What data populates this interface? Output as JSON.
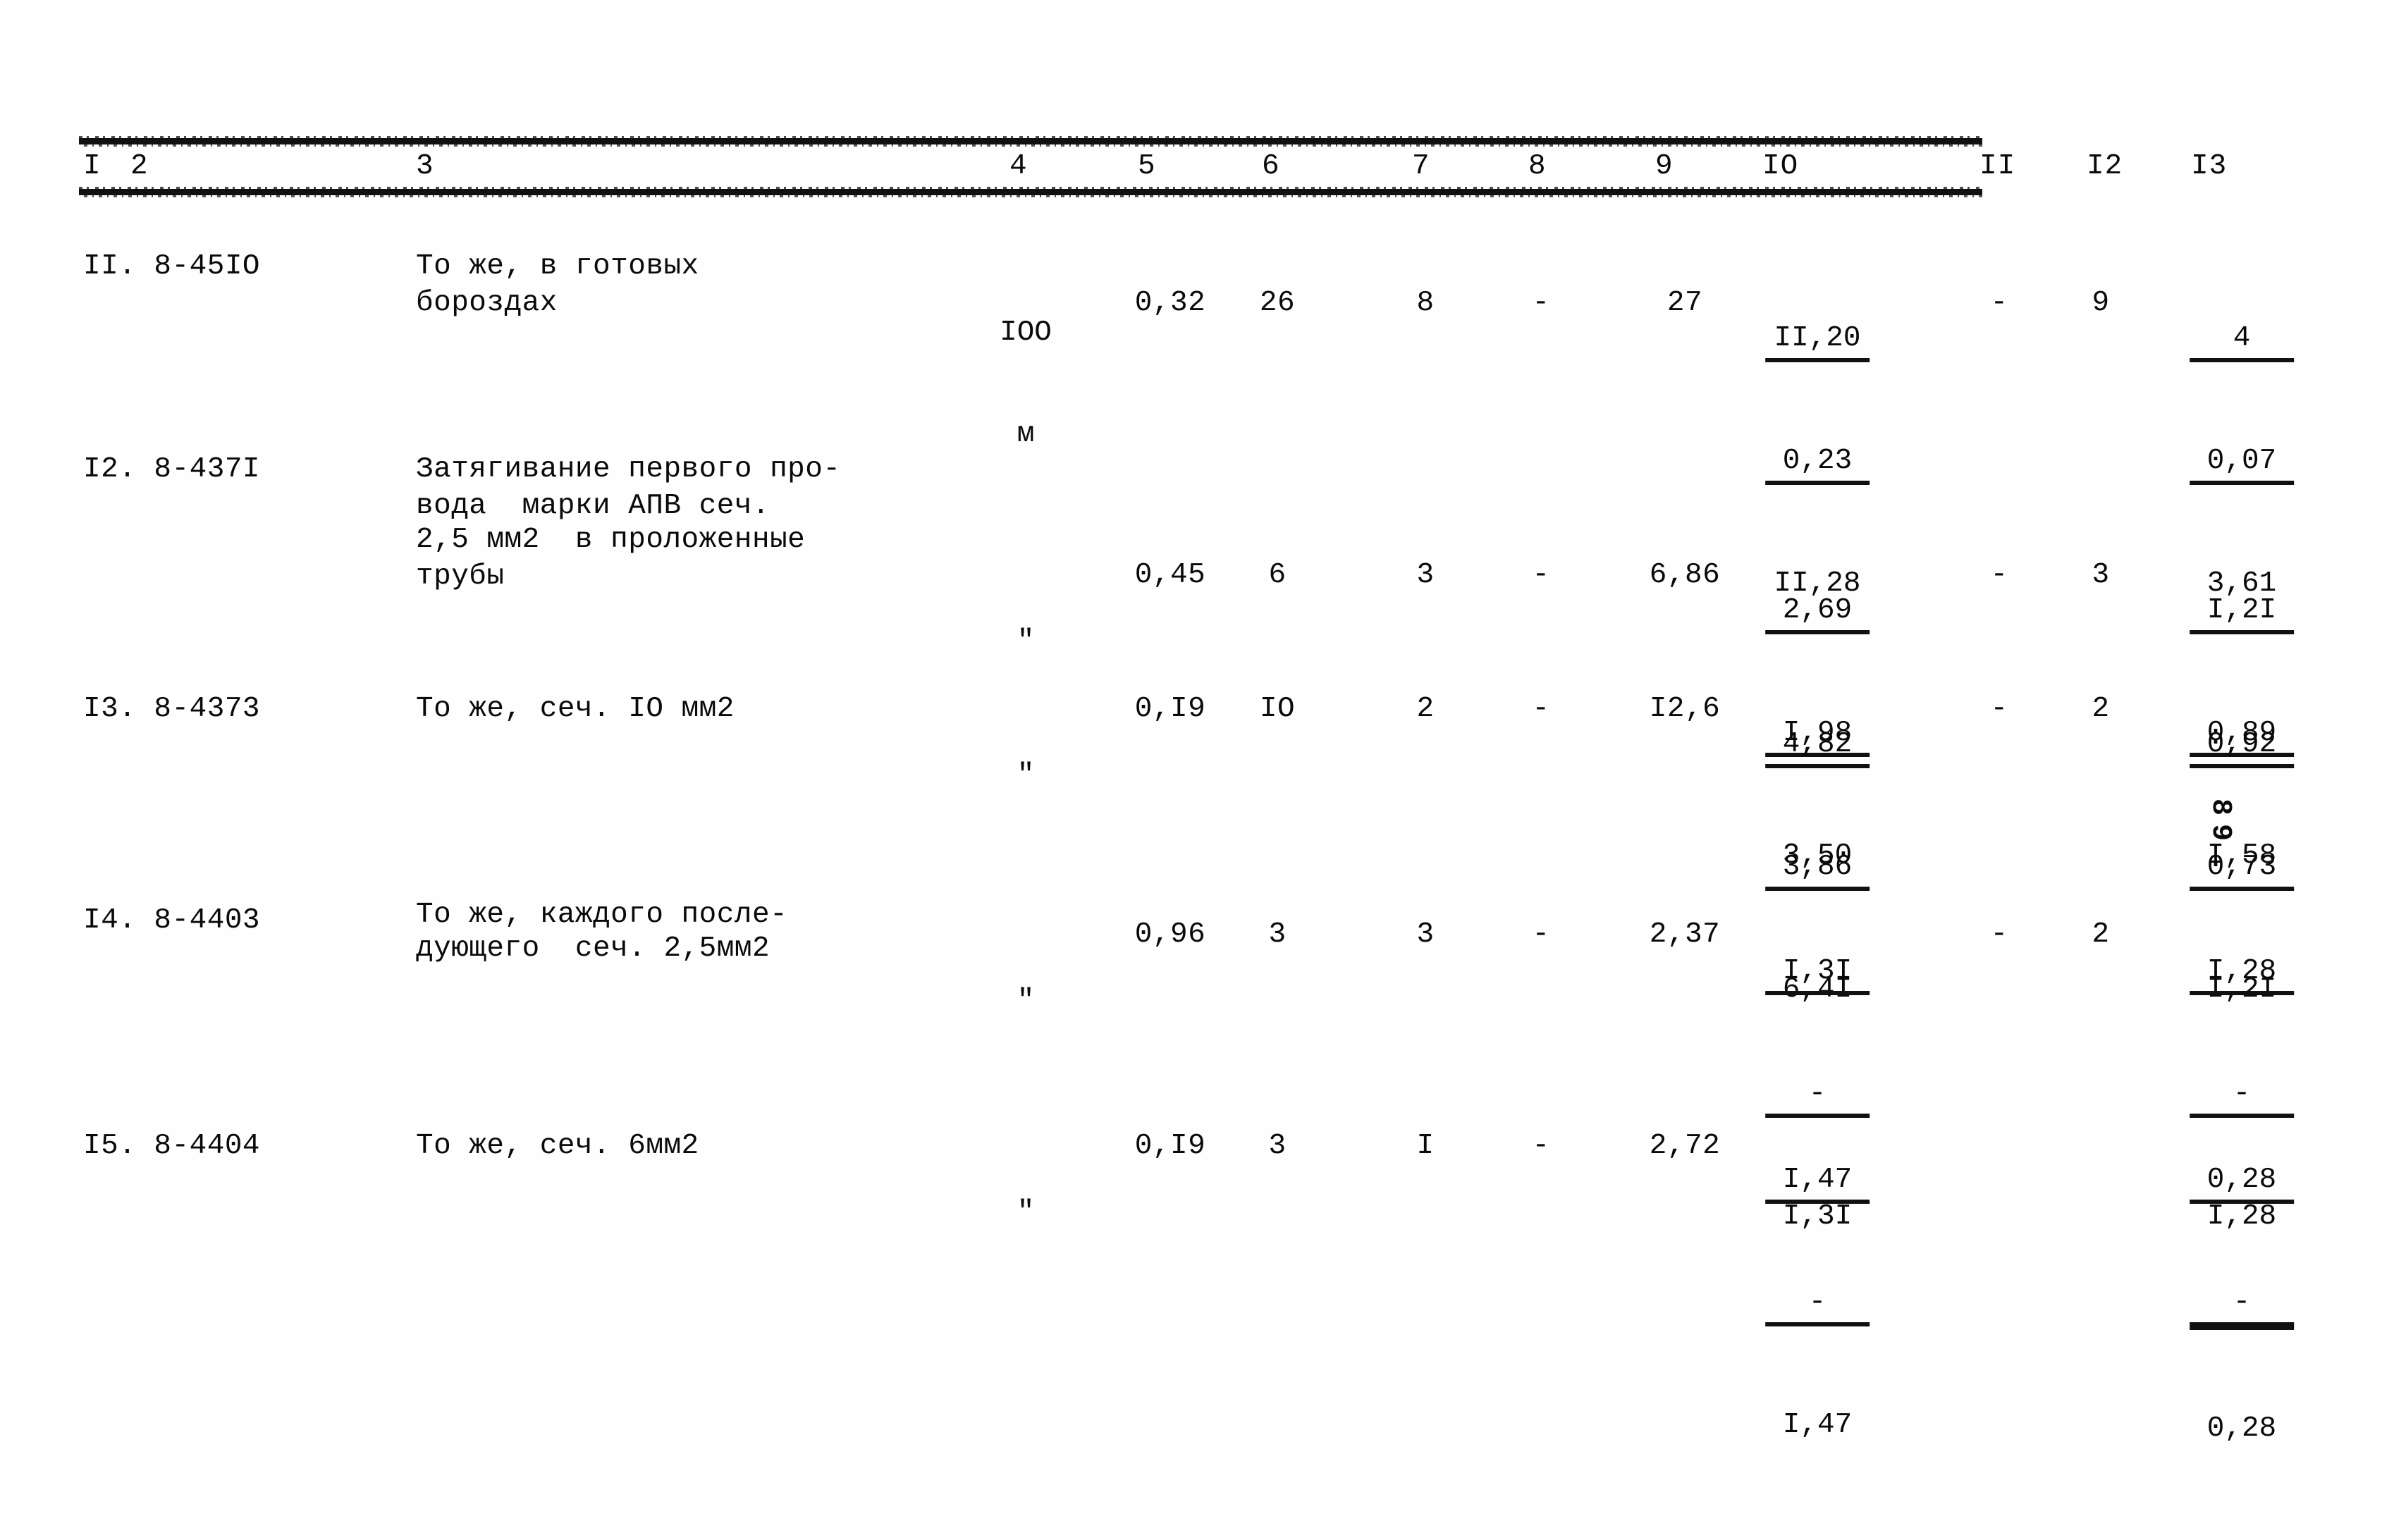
{
  "document": {
    "kind": "scanned-table",
    "column_headers": [
      "I",
      "2",
      "3",
      "4",
      "5",
      "6",
      "7",
      "8",
      "9",
      "IO",
      "II",
      "I2",
      "I3"
    ],
    "stray_mark": "8 9"
  },
  "rows": [
    {
      "num": "II. 8-45IO",
      "desc_lines": [
        "То же, в готовых",
        "бороздах"
      ],
      "unit_lines": [
        "IOO",
        "м"
      ],
      "c5": "0,32",
      "c6": "26",
      "c7": "8",
      "c8": "-",
      "c9": "27",
      "c10": {
        "num": "II,20",
        "mid": "0,23",
        "den": "II,28"
      },
      "c11": "-",
      "c12": "9",
      "c13": {
        "num": "4",
        "mid": "0,07",
        "den": "3,61"
      }
    },
    {
      "num": "I2. 8-437I",
      "desc_lines": [
        "Затягивание первого про-",
        "вода  марки АПВ сеч.",
        "2,5 мм2  в проложенные",
        "трубы"
      ],
      "unit_lines": [
        "\""
      ],
      "c5": "0,45",
      "c6": "6",
      "c7": "3",
      "c8": "-",
      "c9": "6,86",
      "c10": {
        "num": "2,69",
        "mid": "I,98",
        "den": "3,50"
      },
      "c11": "-",
      "c12": "3",
      "c13": {
        "num": "I,2I",
        "mid": "0,89",
        "den": "I,58"
      }
    },
    {
      "num": "I3. 8-4373",
      "desc_lines": [
        "То же, сеч. IO мм2"
      ],
      "unit_lines": [
        "\""
      ],
      "c5": "0,I9",
      "c6": "IO",
      "c7": "2",
      "c8": "-",
      "c9": "I2,6",
      "c10": {
        "num": "4,82",
        "mid": "3,86",
        "den": "6,4I"
      },
      "c11": "-",
      "c12": "2",
      "c13": {
        "num": "0,92",
        "mid": "0,73",
        "den": "I,2I"
      }
    },
    {
      "num": "I4. 8-4403",
      "desc_lines": [
        "То же, каждого после-",
        "дующего  сеч. 2,5мм2"
      ],
      "unit_lines": [
        "\""
      ],
      "c5": "0,96",
      "c6": "3",
      "c7": "3",
      "c8": "-",
      "c9": "2,37",
      "c10": {
        "num": "I,3I",
        "mid": "-",
        "den": "I,3I"
      },
      "c11": "-",
      "c12": "2",
      "c13": {
        "num": "I,28",
        "mid": "-",
        "den": "I,28"
      }
    },
    {
      "num": "I5. 8-4404",
      "desc_lines": [
        "То же, сеч. 6мм2"
      ],
      "unit_lines": [
        "\""
      ],
      "c5": "0,I9",
      "c6": "3",
      "c7": "I",
      "c8": "-",
      "c9": "2,72",
      "c10": {
        "num": "I,47",
        "mid": "-",
        "den": "I,47"
      },
      "c11": "",
      "c12": "",
      "c13": {
        "num": "0,28",
        "mid": "-",
        "den": "0,28"
      }
    }
  ]
}
